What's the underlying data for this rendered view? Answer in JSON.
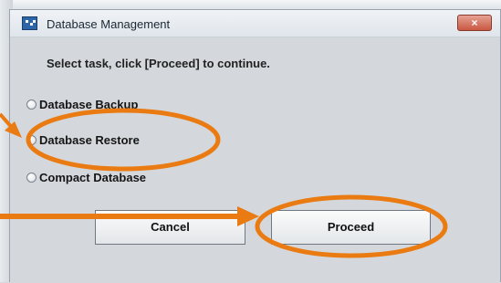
{
  "window": {
    "title": "Database Management",
    "close_label": "×"
  },
  "instruction": "Select task, click [Proceed] to continue.",
  "options": [
    {
      "label": "Database Backup",
      "selected": false
    },
    {
      "label": "Database Restore",
      "selected": false
    },
    {
      "label": "Compact Database",
      "selected": false
    }
  ],
  "buttons": {
    "cancel": "Cancel",
    "proceed": "Proceed"
  },
  "annotations": {
    "color": "#ea7b12"
  },
  "colors": {
    "title_bar": "#e6ebf0",
    "dialog_bg": "#d4d8dc",
    "close_button": "#c85841"
  }
}
